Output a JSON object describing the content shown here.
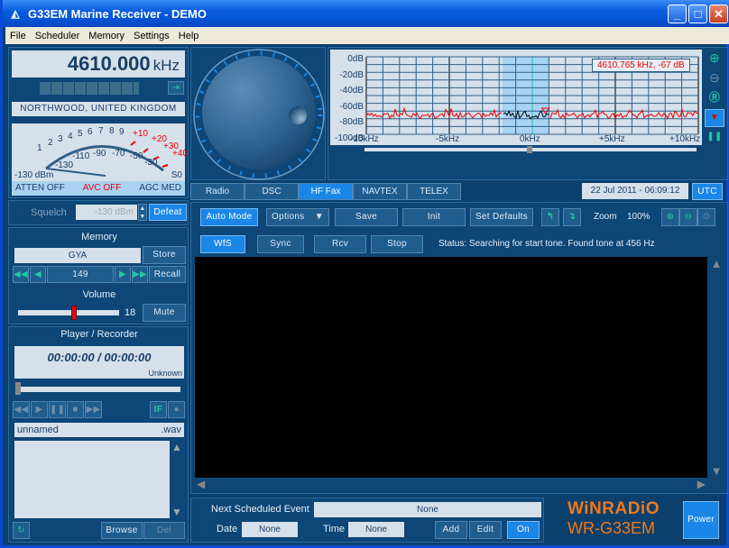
{
  "window": {
    "title": "G33EM Marine Receiver - DEMO"
  },
  "menu": [
    "File",
    "Scheduler",
    "Memory",
    "Settings",
    "Help"
  ],
  "frequency": {
    "value": "4610.000",
    "unit": "kHz"
  },
  "station": "NORTHWOOD, UNITED KINGDOM",
  "smeter": {
    "scale_s": [
      "1",
      "2",
      "3",
      "4",
      "5",
      "6",
      "7",
      "8",
      "9"
    ],
    "scale_plus": [
      "+10",
      "+20",
      "+30",
      "+40"
    ],
    "scale_dbm": [
      "-130",
      "-110",
      "-90",
      "-70",
      "-50",
      "-30"
    ],
    "reading_dbm": "-130 dBm",
    "reading_s": "S0",
    "atten": "ATTEN OFF",
    "avc": "AVC OFF",
    "agc": "AGC MED"
  },
  "squelch": {
    "label": "Squelch",
    "value": "-130 dBm",
    "defeat": "Defeat"
  },
  "memory": {
    "title": "Memory",
    "name": "GYA",
    "store": "Store",
    "channel": "149",
    "recall": "Recall"
  },
  "volume": {
    "title": "Volume",
    "value": "18",
    "level_fraction": 0.55,
    "mute": "Mute"
  },
  "player": {
    "title": "Player / Recorder",
    "time": "00:00:00 / 00:00:00",
    "format": "Unknown",
    "filename": "unnamed",
    "ext": ".wav",
    "browse": "Browse",
    "del": "Del"
  },
  "spectrum": {
    "y_labels": [
      "0dB",
      "-20dB",
      "-40dB",
      "-60dB",
      "-80dB",
      "-100dB"
    ],
    "x_labels": [
      "-10kHz",
      "-5kHz",
      "0kHz",
      "+5kHz",
      "+10kHz"
    ],
    "readout": "4610.765 kHz, -67 dB"
  },
  "tabs": [
    "Radio",
    "DSC",
    "HF Fax",
    "NAVTEX",
    "TELEX"
  ],
  "active_tab": "HF Fax",
  "datetime": "22 Jul 2011 - 06:09:12",
  "utc": "UTC",
  "fax_toolbar": {
    "auto": "Auto Mode",
    "options": "Options",
    "save": "Save",
    "init": "Init",
    "defaults": "Set Defaults",
    "zoom_label": "Zoom",
    "zoom_value": "100%"
  },
  "fax_controls": {
    "wfs": "WfS",
    "sync": "Sync",
    "rcv": "Rcv",
    "stop": "Stop",
    "status": "Status: Searching for start tone. Found tone at 456 Hz"
  },
  "scheduler": {
    "next_label": "Next Scheduled Event",
    "next_value": "None",
    "date_label": "Date",
    "date_value": "None",
    "time_label": "Time",
    "time_value": "None",
    "add": "Add",
    "edit": "Edit",
    "on": "On"
  },
  "brand": {
    "name": "WiNRADiO",
    "model": "WR-G33EM",
    "power": "Power"
  }
}
